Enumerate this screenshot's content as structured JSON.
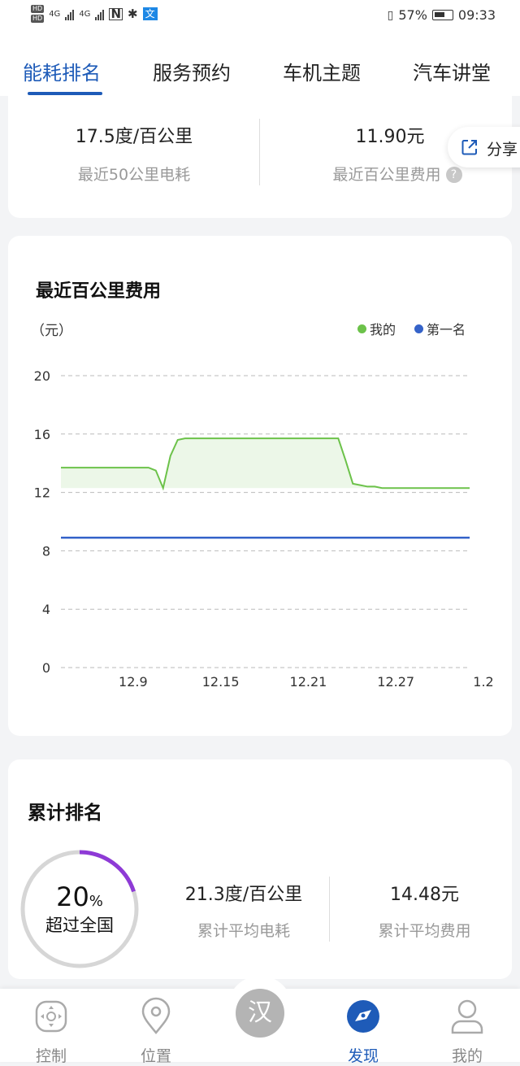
{
  "status_bar": {
    "network": "4G",
    "battery": "57%",
    "time": "09:33"
  },
  "tabs": [
    {
      "label": "能耗排名",
      "active": true
    },
    {
      "label": "服务预约",
      "active": false
    },
    {
      "label": "车机主题",
      "active": false
    },
    {
      "label": "汽车讲堂",
      "active": false
    }
  ],
  "summary": {
    "left_value": "17.5度/百公里",
    "left_label": "最近50公里电耗",
    "right_value": "11.90元",
    "right_label": "最近百公里费用",
    "help_icon": "?"
  },
  "share": {
    "label": "分享"
  },
  "recent_cost_chart": {
    "title": "最近百公里费用",
    "unit": "（元）",
    "legend_mine": "我的",
    "legend_first": "第一名"
  },
  "chart_data": {
    "type": "area",
    "title": "最近百公里费用",
    "ylabel": "（元）",
    "ylim": [
      0,
      20
    ],
    "yticks": [
      "0",
      "4",
      "8",
      "12",
      "16",
      "20"
    ],
    "xticks": [
      "12.9",
      "12.15",
      "12.21",
      "12.27",
      "1.2"
    ],
    "grid": true,
    "legend_position": "top-right",
    "series": [
      {
        "name": "我的",
        "color": "#6cc24a",
        "x": [
          0.0,
          0.5,
          1.0,
          1.5,
          2.0,
          2.5,
          3.0,
          3.5,
          4.0,
          4.5,
          5.0,
          5.5,
          6.0,
          6.5,
          7.0,
          7.5,
          8.0,
          8.5,
          9.0,
          9.5,
          10.0,
          10.5,
          11.0,
          11.5,
          12.0,
          12.5,
          13.0,
          13.5,
          14.0,
          14.5,
          15.0,
          15.5,
          16.0,
          16.5,
          17.0,
          17.5,
          18.0,
          18.5,
          19.0,
          19.5,
          20.0,
          20.5,
          21.0,
          21.5,
          22.0,
          22.5,
          23.0,
          23.5,
          24.0,
          24.5,
          25.0,
          25.5,
          26.0,
          26.5,
          27.0,
          27.5,
          28.0
        ],
        "values": [
          13.7,
          13.7,
          13.7,
          13.7,
          13.7,
          13.7,
          13.7,
          13.7,
          13.7,
          13.7,
          13.7,
          13.7,
          13.7,
          13.5,
          12.3,
          14.5,
          15.6,
          15.7,
          15.7,
          15.7,
          15.7,
          15.7,
          15.7,
          15.7,
          15.7,
          15.7,
          15.7,
          15.7,
          15.7,
          15.7,
          15.7,
          15.7,
          15.7,
          15.7,
          15.7,
          15.7,
          15.7,
          15.7,
          15.7,
          14.2,
          12.6,
          12.5,
          12.4,
          12.4,
          12.3,
          12.3,
          12.3,
          12.3,
          12.3,
          12.3,
          12.3,
          12.3,
          12.3,
          12.3,
          12.3,
          12.3,
          12.3
        ]
      },
      {
        "name": "第一名",
        "color": "#3563c9",
        "x": [
          0,
          28
        ],
        "values": [
          8.9,
          8.9
        ]
      }
    ]
  },
  "cumulative_rank": {
    "title": "累计排名",
    "percent": "20",
    "percent_sign": "%",
    "percent_value": 0.2,
    "exceed_label": "超过全国",
    "avg_consumption_value": "21.3度/百公里",
    "avg_consumption_label": "累计平均电耗",
    "avg_cost_value": "14.48元",
    "avg_cost_label": "累计平均费用"
  },
  "bottom_nav": [
    {
      "label": "控制",
      "icon": "control-icon",
      "active": false
    },
    {
      "label": "位置",
      "icon": "location-icon",
      "active": false
    },
    {
      "label": "汉",
      "icon": "han-logo-icon",
      "active": false
    },
    {
      "label": "发现",
      "icon": "discover-icon",
      "active": true
    },
    {
      "label": "我的",
      "icon": "profile-icon",
      "active": false
    }
  ]
}
